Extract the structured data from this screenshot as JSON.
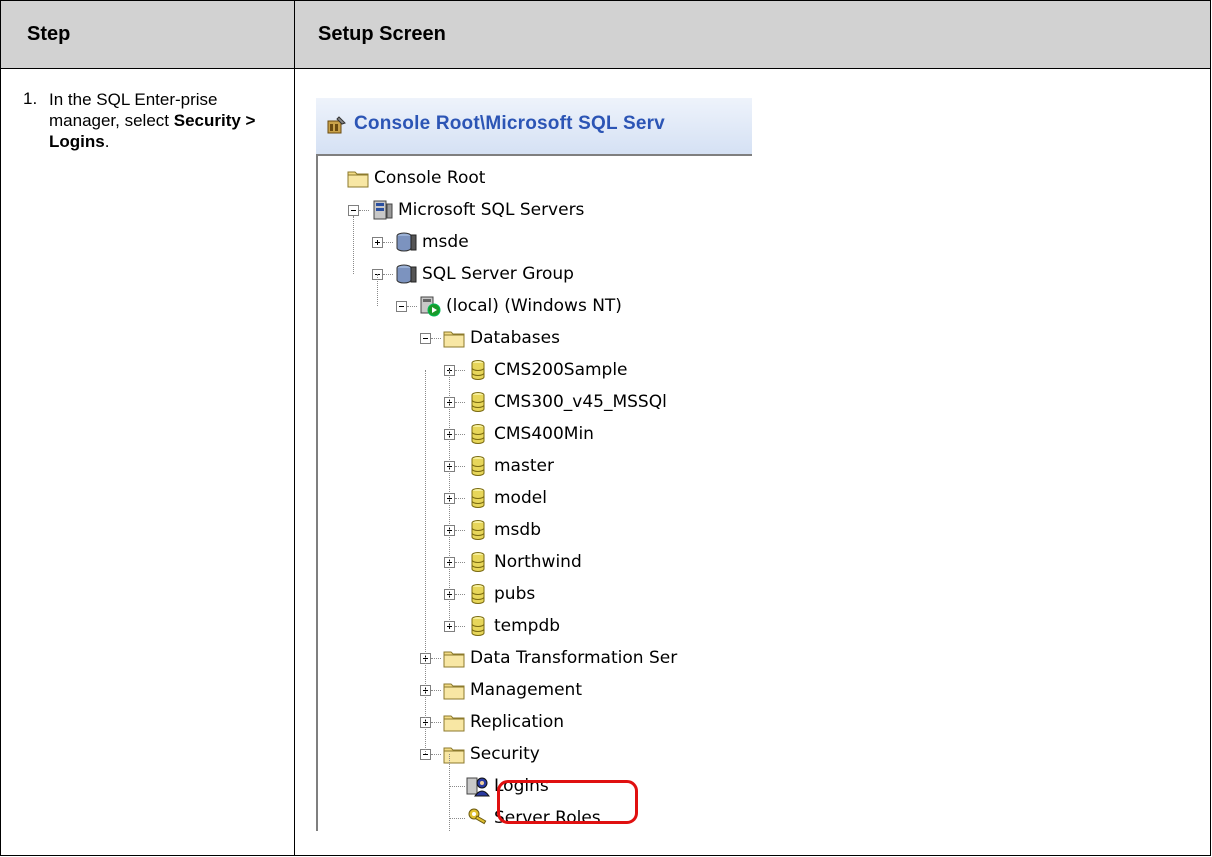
{
  "table": {
    "header_step": "Step",
    "header_setup": "Setup Screen",
    "step_number": "1.",
    "step_text_prefix": "In the SQL Enter-prise manager, select ",
    "step_text_bold1": "Security >",
    "step_text_bold2": "Logins",
    "step_text_suffix": "."
  },
  "screenshot": {
    "title": "Console Root\\Microsoft SQL Serv",
    "tree": [
      {
        "label": "Console Root",
        "icon": "folder-icon"
      },
      {
        "label": "Microsoft SQL Servers",
        "icon": "server-group-icon"
      },
      {
        "label": "msde",
        "icon": "sql-server-icon"
      },
      {
        "label": "SQL Server Group",
        "icon": "sql-server-icon"
      },
      {
        "label": "(local) (Windows NT)",
        "icon": "server-running-icon"
      },
      {
        "label": "Databases",
        "icon": "folder-icon"
      },
      {
        "label": "CMS200Sample",
        "icon": "database-icon"
      },
      {
        "label": "CMS300_v45_MSSQl",
        "icon": "database-icon"
      },
      {
        "label": "CMS400Min",
        "icon": "database-icon"
      },
      {
        "label": "master",
        "icon": "database-icon"
      },
      {
        "label": "model",
        "icon": "database-icon"
      },
      {
        "label": "msdb",
        "icon": "database-icon"
      },
      {
        "label": "Northwind",
        "icon": "database-icon"
      },
      {
        "label": "pubs",
        "icon": "database-icon"
      },
      {
        "label": "tempdb",
        "icon": "database-icon"
      },
      {
        "label": "Data Transformation Ser",
        "icon": "folder-icon"
      },
      {
        "label": "Management",
        "icon": "folder-icon"
      },
      {
        "label": "Replication",
        "icon": "folder-icon"
      },
      {
        "label": "Security",
        "icon": "folder-icon"
      },
      {
        "label": "Logins",
        "icon": "logins-icon"
      },
      {
        "label": "Server Roles",
        "icon": "keys-icon"
      }
    ]
  }
}
